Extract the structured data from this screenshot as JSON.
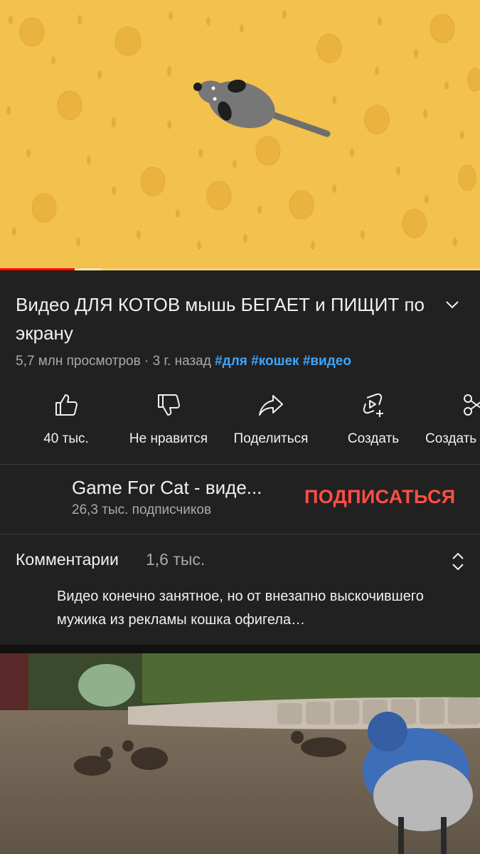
{
  "video": {
    "title": "Видео ДЛЯ КОТОВ мышь БЕГАЕТ и ПИЩИТ по экрану",
    "views": "5,7 млн просмотров",
    "separator": "·",
    "age": "3 г. назад",
    "hashtags": [
      "#для",
      "#кошек",
      "#видео"
    ],
    "progress_played": 0.155,
    "progress_buffered": 0.212
  },
  "actions": [
    {
      "label": "40 тыс.",
      "icon": "thumb-up-icon"
    },
    {
      "label": "Не нравится",
      "icon": "thumb-down-icon"
    },
    {
      "label": "Поделиться",
      "icon": "share-icon"
    },
    {
      "label": "Создать",
      "icon": "create-shorts-icon"
    },
    {
      "label": "Создать",
      "icon": "remix-scissors-icon"
    }
  ],
  "channel": {
    "name": "Game For Cat - виде...",
    "subscribers": "26,3 тыс. подписчиков",
    "subscribe_label": "ПОДПИСАТЬСЯ"
  },
  "comments": {
    "label": "Комментарии",
    "count": "1,6 тыс.",
    "top_comment": "Видео конечно занятное, но от внезапно выскочившего мужика из рекламы кошка офигела…"
  },
  "colors": {
    "background": "#212121",
    "accent_red": "#ff0000",
    "subscribe_red": "#ff4e45",
    "hashtag_blue": "#3ea6ff",
    "cheese_yellow": "#f2c14e"
  }
}
